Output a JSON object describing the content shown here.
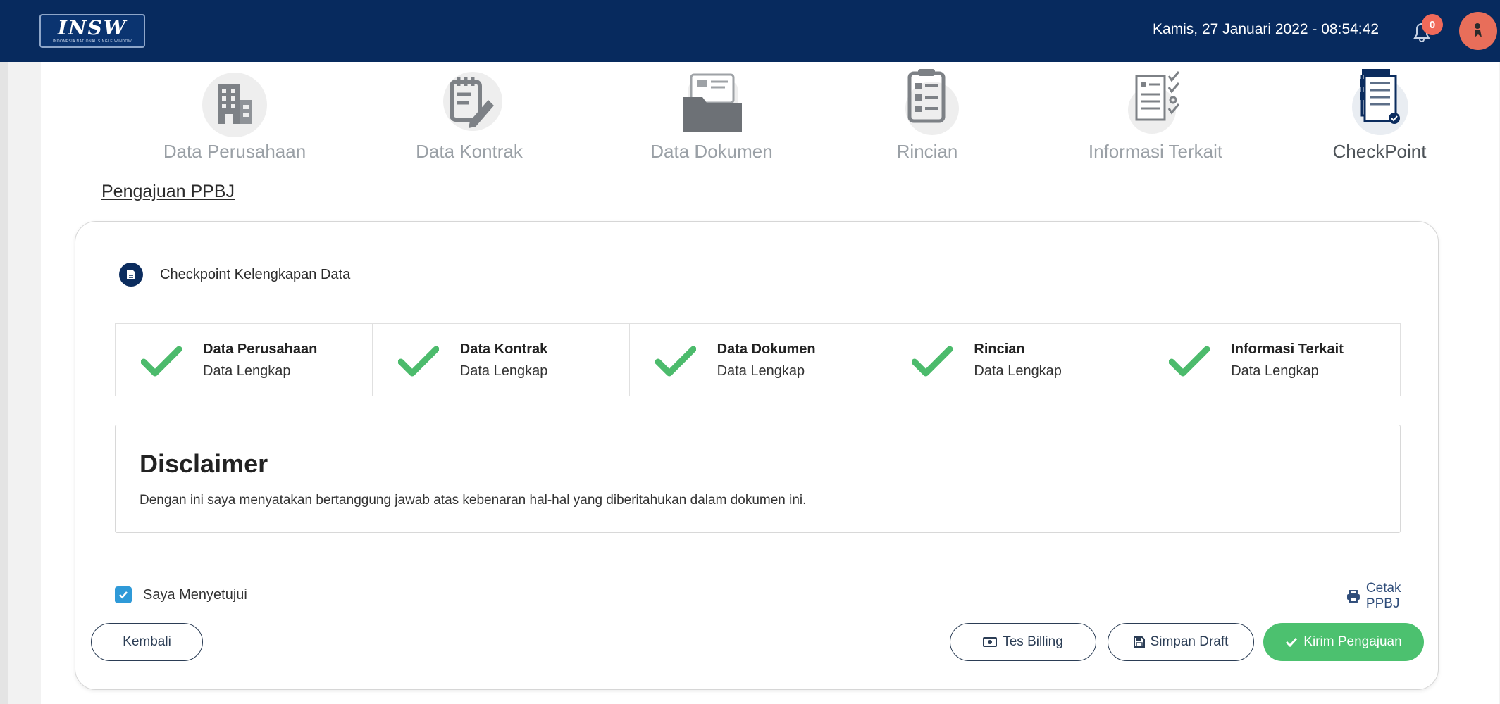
{
  "header": {
    "logo_text": "INSW",
    "logo_subtext": "INDONESIA NATIONAL SINGLE WINDOW",
    "datetime": "Kamis, 27 Januari 2022 - 08:54:42",
    "notification_count": "0",
    "colors": {
      "bar": "#072a5e",
      "badge": "#f06a5a",
      "avatar": "#e86e5a"
    }
  },
  "steps": [
    {
      "label": "Data Perusahaan",
      "icon": "building-icon"
    },
    {
      "label": "Data Kontrak",
      "icon": "contract-edit-icon"
    },
    {
      "label": "Data Dokumen",
      "icon": "folder-icon"
    },
    {
      "label": "Rincian",
      "icon": "clipboard-list-icon"
    },
    {
      "label": "Informasi Terkait",
      "icon": "document-checklist-icon"
    },
    {
      "label": "CheckPoint",
      "icon": "checkpoint-document-icon",
      "active": true
    }
  ],
  "page_title": "Pengajuan PPBJ",
  "checkpoint": {
    "title": "Checkpoint Kelengkapan Data",
    "items": [
      {
        "name": "Data Perusahaan",
        "status": "Data Lengkap"
      },
      {
        "name": "Data Kontrak",
        "status": "Data Lengkap"
      },
      {
        "name": "Data Dokumen",
        "status": "Data Lengkap"
      },
      {
        "name": "Rincian",
        "status": "Data Lengkap"
      },
      {
        "name": "Informasi Terkait",
        "status": "Data Lengkap"
      }
    ],
    "check_color": "#4cbb6c"
  },
  "disclaimer": {
    "title": "Disclaimer",
    "text": "Dengan ini saya menyatakan bertanggung jawab atas kebenaran hal-hal yang diberitahukan dalam dokumen ini."
  },
  "agreement": {
    "label": "Saya Menyetujui",
    "checked": true
  },
  "actions": {
    "print": "Cetak PPBJ",
    "back": "Kembali",
    "test_billing": "Tes Billing",
    "save_draft": "Simpan Draft",
    "submit": "Kirim Pengajuan",
    "submit_color": "#4cc16f"
  }
}
